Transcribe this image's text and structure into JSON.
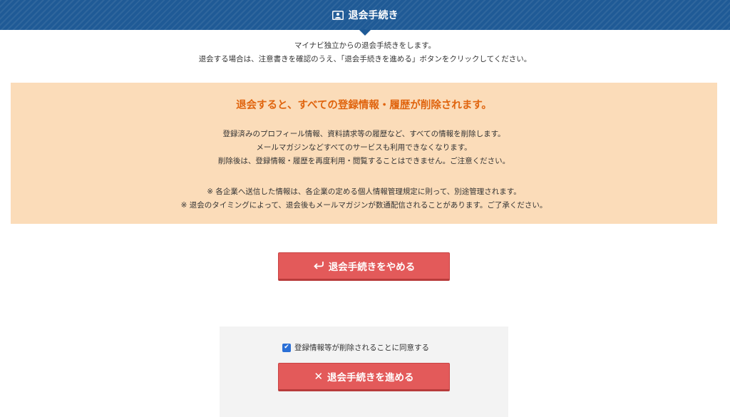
{
  "header": {
    "title": "退会手続き",
    "icon": "id-card-icon",
    "color": "#1f5a96"
  },
  "intro": {
    "line1": "マイナビ独立からの退会手続きをします。",
    "line2": "退会する場合は、注意書きを確認のうえ、「退会手続きを進める」ボタンをクリックしてください。"
  },
  "warning": {
    "title": "退会すると、すべての登録情報・履歴が削除されます。",
    "body": [
      "登録済みのプロフィール情報、資料請求等の履歴など、すべての情報を削除します。",
      "メールマガジンなどすべてのサービスも利用できなくなります。",
      "削除後は、登録情報・履歴を再度利用・閲覧することはできません。ご注意ください。"
    ],
    "notes": [
      "※ 各企業へ送信した情報は、各企業の定める個人情報管理規定に則って、別途管理されます。",
      "※ 退会のタイミングによって、退会後もメールマガジンが数通配信されることがあります。ご了承ください。"
    ],
    "background": "#fbdcb9",
    "title_color": "#e0640e"
  },
  "buttons": {
    "cancel": {
      "label": "退会手続きをやめる",
      "icon": "return-arrow-icon"
    },
    "proceed": {
      "label": "退会手続きを進める",
      "icon": "close-icon"
    },
    "color": "#e35a5a"
  },
  "agreement": {
    "label": "登録情報等が削除されることに同意する",
    "checked": true
  }
}
